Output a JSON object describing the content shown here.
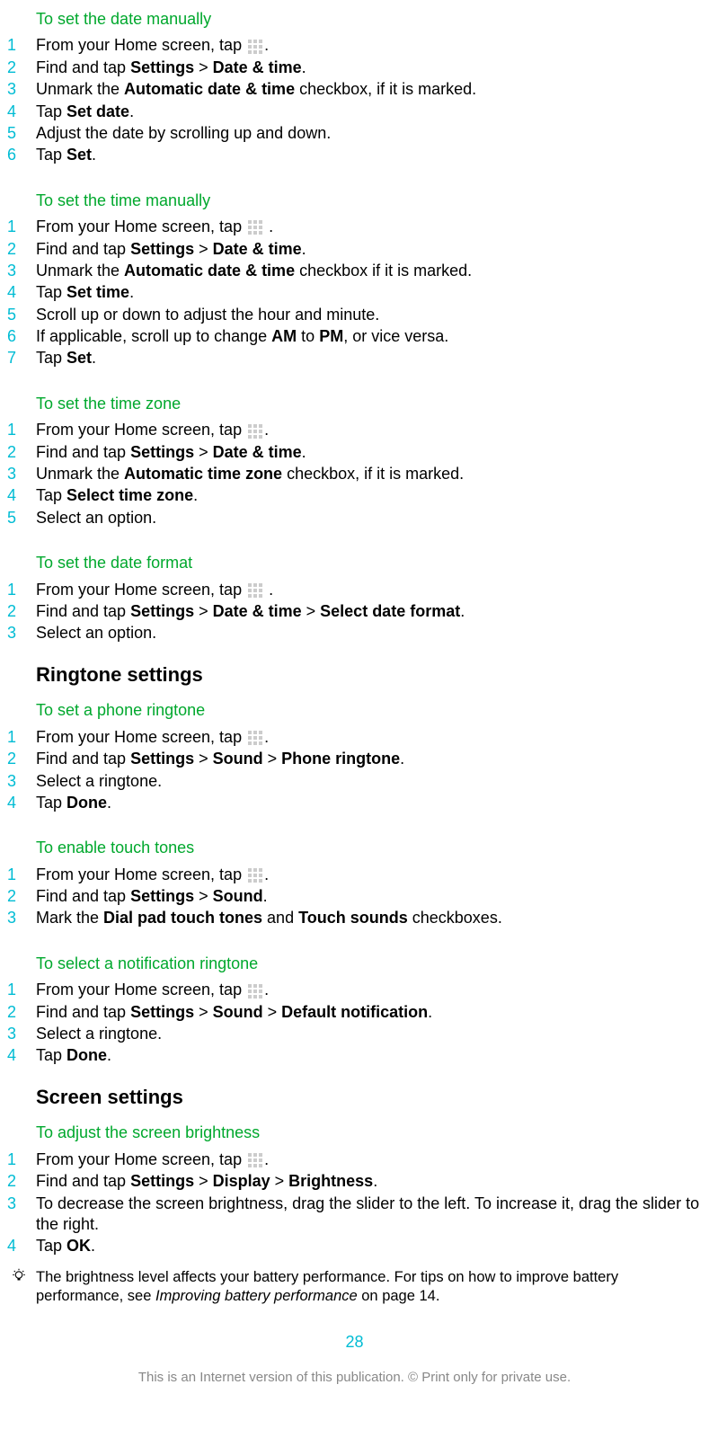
{
  "sections": [
    {
      "title": "To set the date manually",
      "steps": [
        {
          "n": "1",
          "parts": [
            {
              "t": "From your Home screen, tap "
            },
            {
              "icon": true
            },
            {
              "t": "."
            }
          ]
        },
        {
          "n": "2",
          "parts": [
            {
              "t": "Find and tap "
            },
            {
              "b": "Settings"
            },
            {
              "t": " > "
            },
            {
              "b": "Date & time"
            },
            {
              "t": "."
            }
          ]
        },
        {
          "n": "3",
          "parts": [
            {
              "t": "Unmark the "
            },
            {
              "b": "Automatic date & time"
            },
            {
              "t": " checkbox, if it is marked."
            }
          ]
        },
        {
          "n": "4",
          "parts": [
            {
              "t": "Tap "
            },
            {
              "b": "Set date"
            },
            {
              "t": "."
            }
          ]
        },
        {
          "n": "5",
          "parts": [
            {
              "t": "Adjust the date by scrolling up and down."
            }
          ]
        },
        {
          "n": "6",
          "parts": [
            {
              "t": "Tap "
            },
            {
              "b": "Set"
            },
            {
              "t": "."
            }
          ]
        }
      ]
    },
    {
      "title": "To set the time manually",
      "steps": [
        {
          "n": "1",
          "parts": [
            {
              "t": "From your Home screen, tap "
            },
            {
              "icon": true
            },
            {
              "t": " ."
            }
          ]
        },
        {
          "n": "2",
          "parts": [
            {
              "t": "Find and tap "
            },
            {
              "b": "Settings"
            },
            {
              "t": " > "
            },
            {
              "b": "Date & time"
            },
            {
              "t": "."
            }
          ]
        },
        {
          "n": "3",
          "parts": [
            {
              "t": "Unmark the "
            },
            {
              "b": "Automatic date & time"
            },
            {
              "t": " checkbox if it is marked."
            }
          ]
        },
        {
          "n": "4",
          "parts": [
            {
              "t": "Tap "
            },
            {
              "b": "Set time"
            },
            {
              "t": "."
            }
          ]
        },
        {
          "n": "5",
          "parts": [
            {
              "t": "Scroll up or down to adjust the hour and minute."
            }
          ]
        },
        {
          "n": "6",
          "parts": [
            {
              "t": "If applicable, scroll up to change "
            },
            {
              "b": "AM"
            },
            {
              "t": " to "
            },
            {
              "b": "PM"
            },
            {
              "t": ", or vice versa."
            }
          ]
        },
        {
          "n": "7",
          "parts": [
            {
              "t": "Tap "
            },
            {
              "b": "Set"
            },
            {
              "t": "."
            }
          ]
        }
      ]
    },
    {
      "title": "To set the time zone",
      "steps": [
        {
          "n": "1",
          "parts": [
            {
              "t": "From your Home screen, tap "
            },
            {
              "icon": true
            },
            {
              "t": "."
            }
          ]
        },
        {
          "n": "2",
          "parts": [
            {
              "t": "Find and tap "
            },
            {
              "b": "Settings"
            },
            {
              "t": " > "
            },
            {
              "b": "Date & time"
            },
            {
              "t": "."
            }
          ]
        },
        {
          "n": "3",
          "parts": [
            {
              "t": "Unmark the "
            },
            {
              "b": "Automatic time zone"
            },
            {
              "t": " checkbox, if it is marked."
            }
          ]
        },
        {
          "n": "4",
          "parts": [
            {
              "t": "Tap "
            },
            {
              "b": "Select time zone"
            },
            {
              "t": "."
            }
          ]
        },
        {
          "n": "5",
          "parts": [
            {
              "t": "Select an option."
            }
          ]
        }
      ]
    },
    {
      "title": "To set the date format",
      "steps": [
        {
          "n": "1",
          "parts": [
            {
              "t": "From your Home screen, tap "
            },
            {
              "icon": true
            },
            {
              "t": " ."
            }
          ]
        },
        {
          "n": "2",
          "parts": [
            {
              "t": "Find and tap "
            },
            {
              "b": "Settings"
            },
            {
              "t": " > "
            },
            {
              "b": "Date & time"
            },
            {
              "t": " > "
            },
            {
              "b": "Select date format"
            },
            {
              "t": "."
            }
          ]
        },
        {
          "n": "3",
          "parts": [
            {
              "t": "Select an option."
            }
          ]
        }
      ]
    }
  ],
  "heading_ringtone": "Ringtone settings",
  "ringtone_sections": [
    {
      "title": "To set a phone ringtone",
      "steps": [
        {
          "n": "1",
          "parts": [
            {
              "t": "From your Home screen, tap "
            },
            {
              "icon": true
            },
            {
              "t": "."
            }
          ]
        },
        {
          "n": "2",
          "parts": [
            {
              "t": "Find and tap "
            },
            {
              "b": "Settings"
            },
            {
              "t": " > "
            },
            {
              "b": "Sound"
            },
            {
              "t": " > "
            },
            {
              "b": "Phone ringtone"
            },
            {
              "t": "."
            }
          ]
        },
        {
          "n": "3",
          "parts": [
            {
              "t": "Select a ringtone."
            }
          ]
        },
        {
          "n": "4",
          "parts": [
            {
              "t": "Tap "
            },
            {
              "b": "Done"
            },
            {
              "t": "."
            }
          ]
        }
      ]
    },
    {
      "title": "To enable touch tones",
      "steps": [
        {
          "n": "1",
          "parts": [
            {
              "t": "From your Home screen, tap "
            },
            {
              "icon": true
            },
            {
              "t": "."
            }
          ]
        },
        {
          "n": "2",
          "parts": [
            {
              "t": "Find and tap "
            },
            {
              "b": "Settings"
            },
            {
              "t": " > "
            },
            {
              "b": "Sound"
            },
            {
              "t": "."
            }
          ]
        },
        {
          "n": "3",
          "parts": [
            {
              "t": "Mark the "
            },
            {
              "b": "Dial pad touch tones"
            },
            {
              "t": " and "
            },
            {
              "b": "Touch sounds"
            },
            {
              "t": " checkboxes."
            }
          ]
        }
      ]
    },
    {
      "title": "To select a notification ringtone",
      "steps": [
        {
          "n": "1",
          "parts": [
            {
              "t": "From your Home screen, tap "
            },
            {
              "icon": true
            },
            {
              "t": "."
            }
          ]
        },
        {
          "n": "2",
          "parts": [
            {
              "t": "Find and tap "
            },
            {
              "b": "Settings"
            },
            {
              "t": " > "
            },
            {
              "b": "Sound"
            },
            {
              "t": " > "
            },
            {
              "b": "Default notification"
            },
            {
              "t": "."
            }
          ]
        },
        {
          "n": "3",
          "parts": [
            {
              "t": "Select a ringtone."
            }
          ]
        },
        {
          "n": "4",
          "parts": [
            {
              "t": "Tap "
            },
            {
              "b": "Done"
            },
            {
              "t": "."
            }
          ]
        }
      ]
    }
  ],
  "heading_screen": "Screen settings",
  "screen_sections": [
    {
      "title": "To adjust the screen brightness",
      "steps": [
        {
          "n": "1",
          "parts": [
            {
              "t": "From your Home screen, tap "
            },
            {
              "icon": true
            },
            {
              "t": "."
            }
          ]
        },
        {
          "n": "2",
          "parts": [
            {
              "t": "Find and tap "
            },
            {
              "b": "Settings"
            },
            {
              "t": " > "
            },
            {
              "b": "Display"
            },
            {
              "t": " > "
            },
            {
              "b": "Brightness"
            },
            {
              "t": "."
            }
          ]
        },
        {
          "n": "3",
          "parts": [
            {
              "t": "To decrease the screen brightness, drag the slider to the left. To increase it, drag the slider to the right."
            }
          ]
        },
        {
          "n": "4",
          "parts": [
            {
              "t": "Tap "
            },
            {
              "b": "OK"
            },
            {
              "t": "."
            }
          ]
        }
      ]
    }
  ],
  "tip": {
    "parts": [
      {
        "t": "The brightness level affects your battery performance. For tips on how to improve battery performance, see "
      },
      {
        "i": "Improving battery performance"
      },
      {
        "t": " on page 14."
      }
    ]
  },
  "page_number": "28",
  "footer": "This is an Internet version of this publication. © Print only for private use."
}
